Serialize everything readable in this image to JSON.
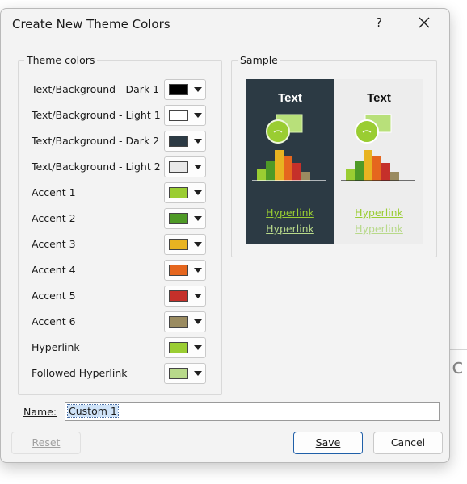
{
  "dialog": {
    "title": "Create New Theme Colors",
    "help_label": "?",
    "groups": {
      "theme_colors": "Theme colors",
      "sample": "Sample"
    },
    "rows": [
      {
        "label": "Text/Background - Dark 1",
        "color": "#000000"
      },
      {
        "label": "Text/Background - Light 1",
        "color": "#ffffff"
      },
      {
        "label": "Text/Background - Dark 2",
        "color": "#2c3a44"
      },
      {
        "label": "Text/Background - Light 2",
        "color": "#e8e8e8"
      },
      {
        "label": "Accent 1",
        "color": "#9acd32"
      },
      {
        "label": "Accent 2",
        "color": "#4e9a26"
      },
      {
        "label": "Accent 3",
        "color": "#e8b321"
      },
      {
        "label": "Accent 4",
        "color": "#e5661e"
      },
      {
        "label": "Accent 5",
        "color": "#c5302a"
      },
      {
        "label": "Accent 6",
        "color": "#9a8b60"
      },
      {
        "label": "Hyperlink",
        "color": "#9acd32"
      },
      {
        "label": "Followed Hyperlink",
        "color": "#b8d98a"
      }
    ],
    "sample": {
      "text_label": "Text",
      "hyperlink_label": "Hyperlink",
      "followed_hyperlink_label": "Hyperlink",
      "dark_bg": "#2c3a44",
      "light_bg": "#ededed",
      "hyperlink_color": "#9acd32",
      "followed_color": "#b8d98a"
    },
    "name": {
      "label": "Name:",
      "value": "Custom 1"
    },
    "buttons": {
      "reset": "Reset",
      "save": "Save",
      "cancel": "Cancel"
    }
  }
}
